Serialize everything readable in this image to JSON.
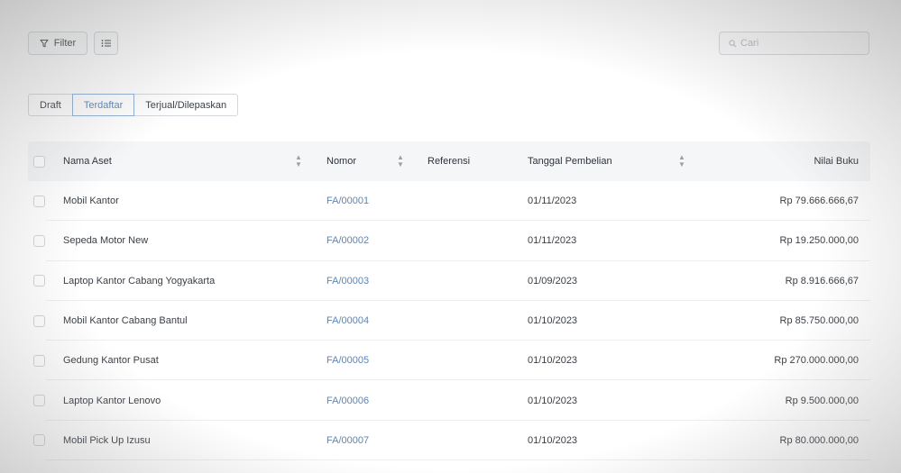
{
  "toolbar": {
    "filter_label": "Filter",
    "search_placeholder": "Cari"
  },
  "tabs": [
    {
      "label": "Draft",
      "active": false
    },
    {
      "label": "Terdaftar",
      "active": true
    },
    {
      "label": "Terjual/Dilepaskan",
      "active": false
    }
  ],
  "table": {
    "columns": {
      "name": "Nama Aset",
      "nomor": "Nomor",
      "referensi": "Referensi",
      "tanggal": "Tanggal Pembelian",
      "nilai": "Nilai Buku"
    },
    "rows": [
      {
        "name": "Mobil Kantor",
        "nomor": "FA/00001",
        "referensi": "",
        "tanggal": "01/11/2023",
        "nilai": "Rp 79.666.666,67"
      },
      {
        "name": "Sepeda Motor New",
        "nomor": "FA/00002",
        "referensi": "",
        "tanggal": "01/11/2023",
        "nilai": "Rp 19.250.000,00"
      },
      {
        "name": "Laptop Kantor Cabang Yogyakarta",
        "nomor": "FA/00003",
        "referensi": "",
        "tanggal": "01/09/2023",
        "nilai": "Rp 8.916.666,67"
      },
      {
        "name": "Mobil Kantor Cabang Bantul",
        "nomor": "FA/00004",
        "referensi": "",
        "tanggal": "01/10/2023",
        "nilai": "Rp 85.750.000,00"
      },
      {
        "name": "Gedung Kantor Pusat",
        "nomor": "FA/00005",
        "referensi": "",
        "tanggal": "01/10/2023",
        "nilai": "Rp 270.000.000,00"
      },
      {
        "name": "Laptop Kantor Lenovo",
        "nomor": "FA/00006",
        "referensi": "",
        "tanggal": "01/10/2023",
        "nilai": "Rp 9.500.000,00"
      },
      {
        "name": "Mobil Pick Up Izusu",
        "nomor": "FA/00007",
        "referensi": "",
        "tanggal": "01/10/2023",
        "nilai": "Rp 80.000.000,00"
      }
    ]
  },
  "colors": {
    "link": "#5a86b8",
    "header_bg": "#f4f6f8",
    "border": "#d4d8dc"
  },
  "icons": {
    "filter": "filter-icon",
    "list": "list-icon",
    "search": "search-icon",
    "sort": "sort-icon"
  }
}
